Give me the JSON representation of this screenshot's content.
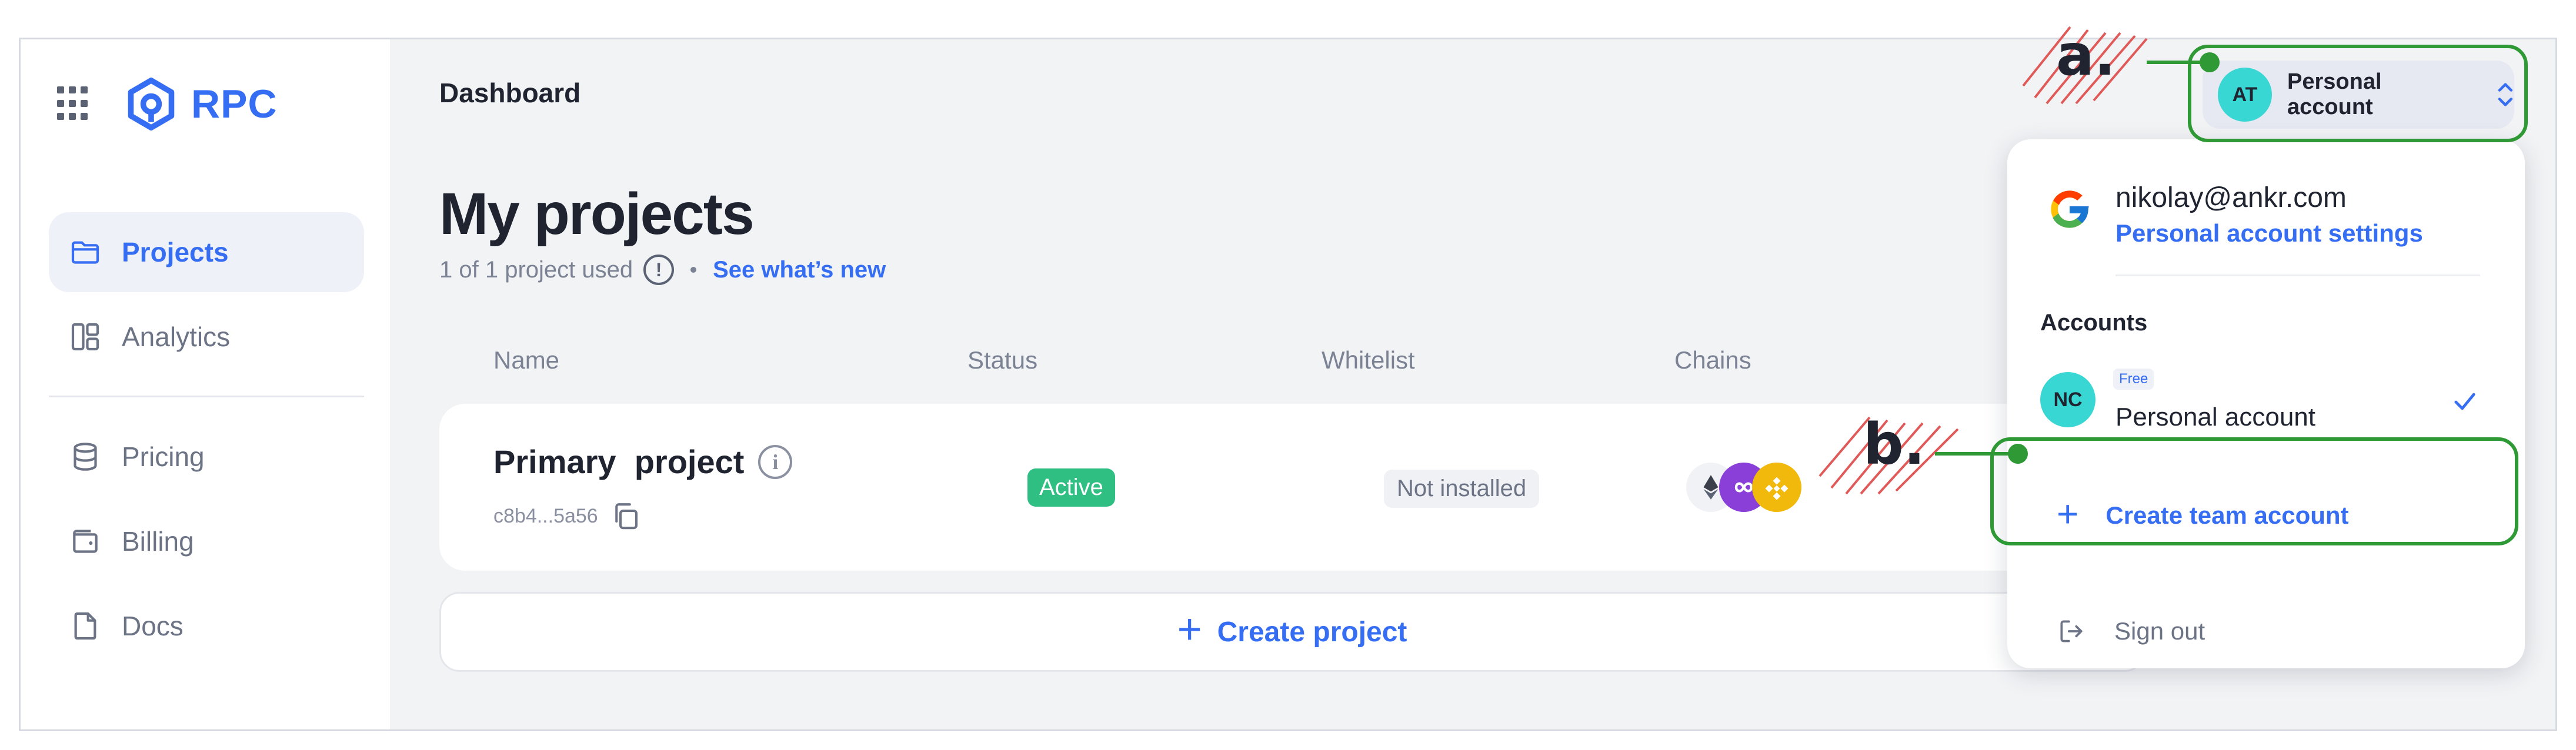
{
  "sidebar": {
    "brand": "RPC",
    "items": [
      {
        "label": "Projects",
        "icon": "folder-icon",
        "active": true
      },
      {
        "label": "Analytics",
        "icon": "layout-icon",
        "active": false
      },
      {
        "label": "Pricing",
        "icon": "database-icon",
        "active": false
      },
      {
        "label": "Billing",
        "icon": "wallet-icon",
        "active": false
      },
      {
        "label": "Docs",
        "icon": "document-icon",
        "active": false
      }
    ]
  },
  "header": {
    "title": "Dashboard",
    "account_switcher": {
      "initials": "AT",
      "label": "Personal account"
    }
  },
  "main": {
    "page_title": "My projects",
    "usage_text": "1 of 1 project used",
    "usage_info": "!",
    "whats_new_link": "See what’s new",
    "columns": [
      "Name",
      "Status",
      "Whitelist",
      "Chains"
    ],
    "project": {
      "name": "Primary  project",
      "info": "i",
      "id": "c8b4...5a56",
      "status": "Active",
      "whitelist": "Not installed",
      "chains": [
        "ethereum-icon",
        "multichain-icon",
        "bnb-icon"
      ]
    },
    "create_project_label": "Create project",
    "plus": "+"
  },
  "dropdown": {
    "email": "nikolay@ankr.com",
    "settings_link": "Personal account settings",
    "accounts_heading": "Accounts",
    "account": {
      "initials": "NC",
      "badge": "Free",
      "name": "Personal account",
      "selected": true
    },
    "create_team_label": "Create team account",
    "sign_out_label": "Sign out"
  },
  "annotations": {
    "a": "a.",
    "b": "b."
  },
  "colors": {
    "accent": "#356df3",
    "annotation": "#2f9a35",
    "hatch": "#e05a5a",
    "active_badge": "#2fbf83",
    "avatar": "#39d7d3"
  }
}
